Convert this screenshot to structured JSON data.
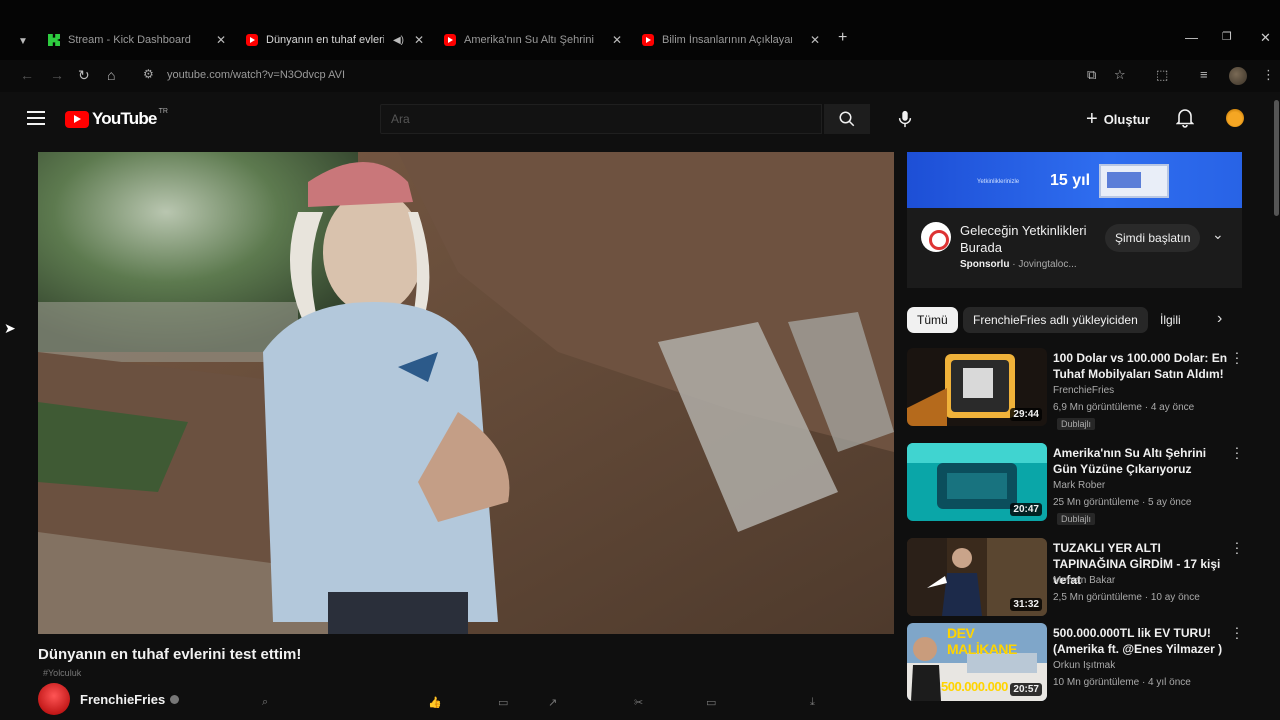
{
  "browser": {
    "tabs": [
      {
        "title": "Stream - Kick Dashboard",
        "icon": "kick-icon"
      },
      {
        "title": "Dünyanın en tuhaf evlerini",
        "icon": "youtube-icon",
        "active": true
      },
      {
        "title": "Amerika'nın Su Altı Şehrini Gü",
        "icon": "youtube-icon"
      },
      {
        "title": "Bilim İnsanlarının Açıklayamad",
        "icon": "youtube-icon"
      }
    ],
    "new_tab": "+",
    "url": "youtube.com/watch?v=N3Odvcp AVI"
  },
  "header": {
    "logo_text": "YouTube",
    "logo_badge": "TR",
    "search_placeholder": "Ara",
    "create_label": "Oluştur"
  },
  "video": {
    "title": "Dünyanın en tuhaf evlerini test ettim!",
    "subtitle": "#Yolculuk",
    "channel": "FrenchieFries"
  },
  "ad": {
    "banner_text": "15 yıl",
    "banner_small": "Yetkinliklerinizle",
    "title": "Geleceğin Yetkinlikleri Burada",
    "sponsor_label": "Sponsorlu",
    "sponsor_site": "· Jovingtaloc...",
    "cta": "Şimdi başlatın"
  },
  "chips": [
    "Tümü",
    "FrenchieFries adlı yükleyiciden",
    "İlgili"
  ],
  "recommendations": [
    {
      "title": "100 Dolar vs 100.000 Dolar: En Tuhaf Mobilyaları Satın Aldım!",
      "channel": "FrenchieFries",
      "meta": "6,9 Mn görüntüleme · 4 ay önce",
      "badge": "Dublajlı",
      "duration": "29:44"
    },
    {
      "title": "Amerika'nın Su Altı Şehrini Gün Yüzüne Çıkarıyoruz",
      "channel": "Mark Rober",
      "meta": "25 Mn görüntüleme · 5 ay önce",
      "badge": "Dublajlı",
      "duration": "20:47"
    },
    {
      "title": "TUZAKLI YER ALTI TAPINAĞINA GİRDİM - 17 kişi vefat",
      "channel": "Mervan Bakar",
      "meta": "2,5 Mn görüntüleme · 10 ay önce",
      "badge": "",
      "duration": "31:32"
    },
    {
      "title": "500.000.000TL lik EV TURU! (Amerika ft. @Enes Yilmazer )",
      "channel": "Orkun Işıtmak",
      "meta": "10 Mn görüntüleme · 4 yıl önce",
      "badge": "",
      "duration": "20:57"
    }
  ],
  "thumb4_text": "DEV MALİKANE",
  "thumb4_price": "500.000.000"
}
